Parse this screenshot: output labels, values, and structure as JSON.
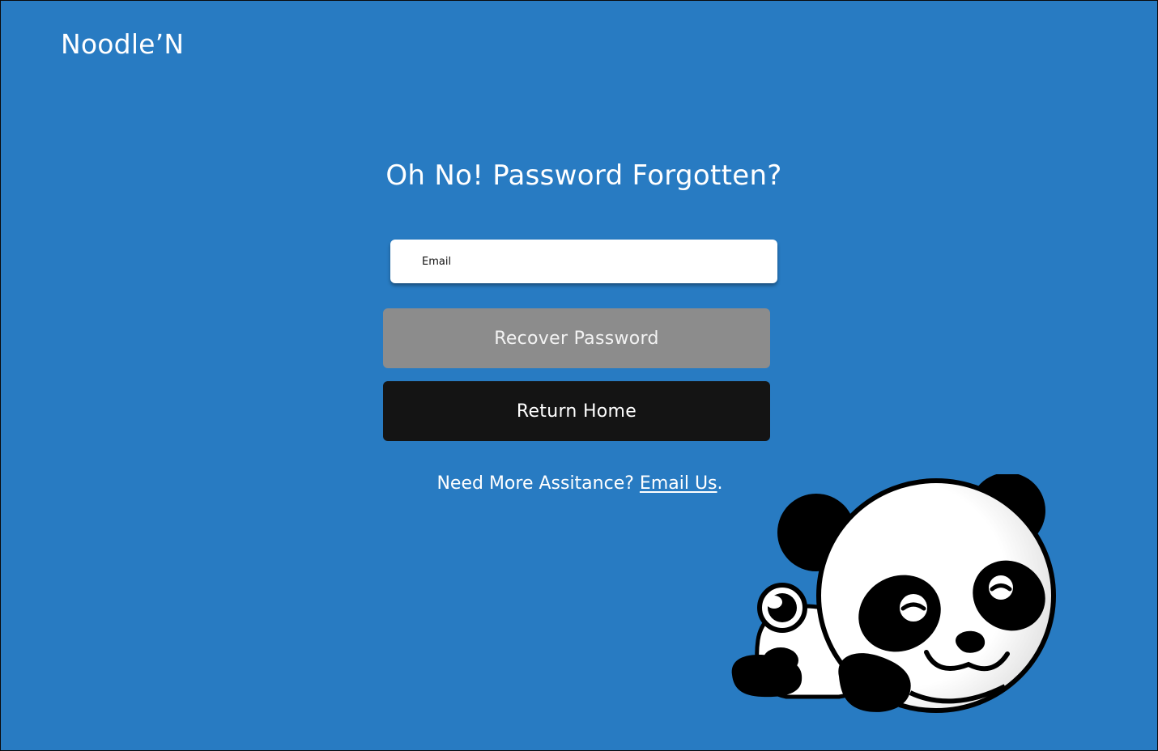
{
  "brand": {
    "name": "Noodle’N"
  },
  "main": {
    "title": "Oh No! Password Forgotten?",
    "email": {
      "placeholder": "Email",
      "value": ""
    },
    "recover_label": "Recover Password",
    "home_label": "Return Home"
  },
  "help": {
    "prefix": "Need More Assitance? ",
    "link_label": "Email Us",
    "suffix": "."
  },
  "colors": {
    "background": "#287bc2",
    "recover_button": "#8c8c8c",
    "home_button": "#141414",
    "text": "#ffffff"
  },
  "illustration": {
    "icon": "panda-mascot-icon"
  }
}
